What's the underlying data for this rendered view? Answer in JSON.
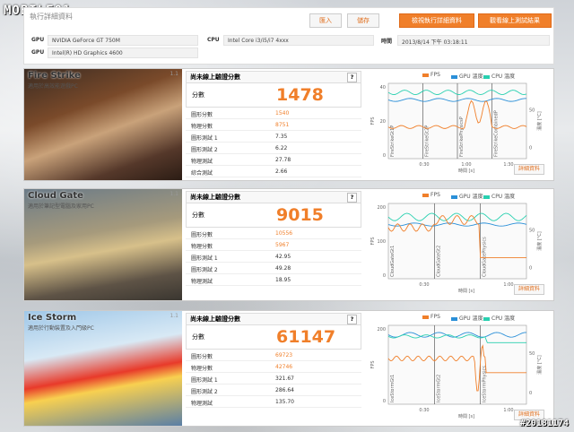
{
  "watermark_top": "MOBILE01",
  "watermark_bottom": "#20181174",
  "header": {
    "title": "執行詳細資料",
    "btn_import": "匯入",
    "btn_save": "儲存",
    "btn_view_online": "檢視執行詳細資料",
    "btn_view_results": "觀看線上測試結果",
    "gpu_label": "GPU",
    "gpu1": "NVIDIA GeForce GT 750M",
    "gpu2": "Intel(R) HD Graphics 4600",
    "cpu_label": "CPU",
    "cpu": "Intel Core i3/i5/i7 4xxx",
    "time_label": "時間",
    "time": "2013/8/14 下午 03:18:11"
  },
  "panels": [
    {
      "name": "Fire Strike",
      "subtitle": "適用於高效能遊戲PC",
      "ratio": "1.1",
      "head": "尚未線上驗證分數",
      "score_label": "分數",
      "score": "1478",
      "rows": [
        {
          "k": "圖形分數",
          "v": "1540",
          "orange": true
        },
        {
          "k": "物理分數",
          "v": "8751",
          "orange": true
        },
        {
          "k": "圖形測試 1",
          "v": "7.35"
        },
        {
          "k": "圖形測試 2",
          "v": "6.22"
        },
        {
          "k": "物理測試",
          "v": "27.78"
        },
        {
          "k": "綜合測試",
          "v": "2.66"
        }
      ],
      "detail": "詳細資料",
      "chart": {
        "legend": [
          "FPS",
          "GPU 溫度",
          "CPU 溫度"
        ],
        "colors": [
          "#f07f2a",
          "#2a8fd8",
          "#29d0b0"
        ],
        "yleft": [
          "40",
          "20",
          "0"
        ],
        "yright": [
          "50",
          "0"
        ],
        "xticks": [
          "0:30",
          "1:00",
          "1:30"
        ],
        "xlabel": "時間 [s]",
        "yleft_label": "FPS",
        "yright_label": "溫度 [°C]",
        "segments": [
          "FireStrikeGt1P",
          "FireStrikeGt2P",
          "FireStrikePhysicsP",
          "FireStrikeCombinedP"
        ]
      }
    },
    {
      "name": "Cloud Gate",
      "subtitle": "適用於筆記型電腦及家用PC",
      "ratio": "1.1",
      "head": "尚未線上驗證分數",
      "score_label": "分數",
      "score": "9015",
      "rows": [
        {
          "k": "圖形分數",
          "v": "10556",
          "orange": true
        },
        {
          "k": "物理分數",
          "v": "5967",
          "orange": true
        },
        {
          "k": "圖形測試 1",
          "v": "42.95"
        },
        {
          "k": "圖形測試 2",
          "v": "49.28"
        },
        {
          "k": "物理測試",
          "v": "18.95"
        }
      ],
      "detail": "詳細資料",
      "chart": {
        "legend": [
          "FPS",
          "GPU 溫度",
          "CPU 溫度"
        ],
        "colors": [
          "#f07f2a",
          "#2a8fd8",
          "#29d0b0"
        ],
        "yleft": [
          "200",
          "100",
          "0"
        ],
        "yright": [
          "50",
          "0"
        ],
        "xticks": [
          "0:30",
          "1:00"
        ],
        "xlabel": "時間 [s]",
        "yleft_label": "FPS",
        "yright_label": "溫度 [°C]",
        "segments": [
          "CloudGateGt1",
          "CloudGateGt2",
          "CloudGatePhysics"
        ]
      }
    },
    {
      "name": "Ice Storm",
      "subtitle": "適用於行動裝置及入門級PC",
      "ratio": "1.1",
      "head": "尚未線上驗證分數",
      "score_label": "分數",
      "score": "61147",
      "rows": [
        {
          "k": "圖形分數",
          "v": "69723",
          "orange": true
        },
        {
          "k": "物理分數",
          "v": "42746",
          "orange": true
        },
        {
          "k": "圖形測試 1",
          "v": "321.67"
        },
        {
          "k": "圖形測試 2",
          "v": "286.64"
        },
        {
          "k": "物理測試",
          "v": "135.70"
        }
      ],
      "detail": "詳細資料",
      "chart": {
        "legend": [
          "FPS",
          "GPU 溫度",
          "CPU 溫度"
        ],
        "colors": [
          "#f07f2a",
          "#2a8fd8",
          "#29d0b0"
        ],
        "yleft": [
          "200",
          "0"
        ],
        "yright": [
          "50",
          "0"
        ],
        "xticks": [
          "0:30",
          "1:00"
        ],
        "xlabel": "時間 [s]",
        "yleft_label": "FPS",
        "yright_label": "溫度 [°C]",
        "segments": [
          "IceStormGt1",
          "IceStormGt2",
          "IceStormPhysics"
        ]
      }
    }
  ]
}
